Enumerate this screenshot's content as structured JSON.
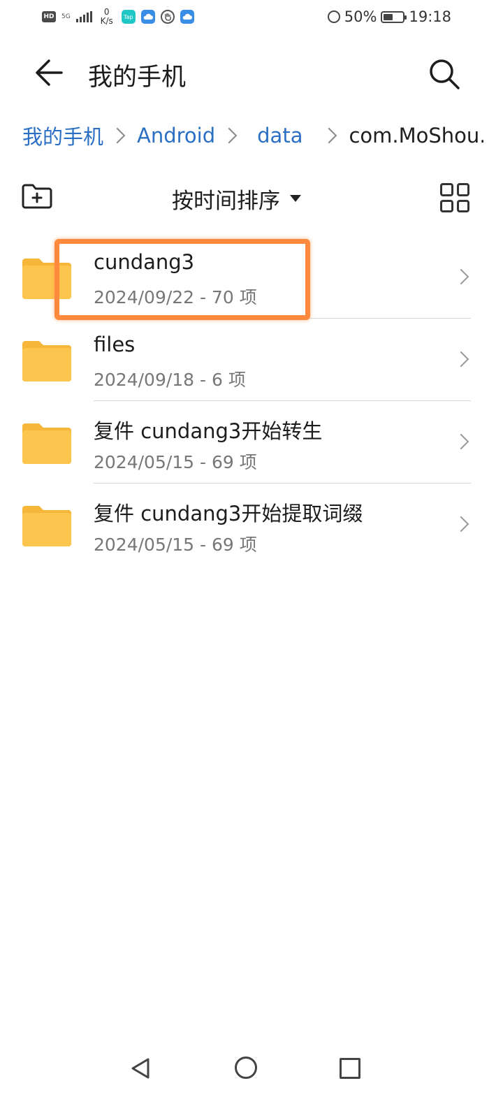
{
  "status_bar": {
    "hd_badge": "HD",
    "network_type": "5G",
    "speed_value": "0",
    "speed_unit": "K/s",
    "app_icons": [
      "tap-icon",
      "cloud-icon",
      "hand-icon",
      "cloud-icon"
    ],
    "battery_percent": "50%",
    "battery_level": 0.5,
    "time": "19:18"
  },
  "header": {
    "title": "我的手机",
    "back_icon": "arrow-left-icon",
    "search_icon": "search-icon"
  },
  "breadcrumb": [
    {
      "label": "我的手机",
      "current": false
    },
    {
      "label": "Android",
      "current": false
    },
    {
      "label": "data",
      "current": false
    },
    {
      "label": "com.MoShou...",
      "current": true
    }
  ],
  "toolbar": {
    "sort_label": "按时间排序",
    "new_folder_icon": "folder-plus-icon",
    "grid_view_icon": "grid-view-icon"
  },
  "files": [
    {
      "name": "cundang3",
      "meta": "2024/09/22 - 70 项",
      "highlighted": true
    },
    {
      "name": "files",
      "meta": "2024/09/18 - 6 项",
      "highlighted": false
    },
    {
      "name": "复件 cundang3开始转生",
      "meta": "2024/05/15 - 69 项",
      "highlighted": false
    },
    {
      "name": "复件 cundang3开始提取词缀",
      "meta": "2024/05/15 - 69 项",
      "highlighted": false
    }
  ],
  "colors": {
    "accent_link": "#2a6fc4",
    "folder": "#fcc54e",
    "highlight": "#ff8a3d"
  }
}
